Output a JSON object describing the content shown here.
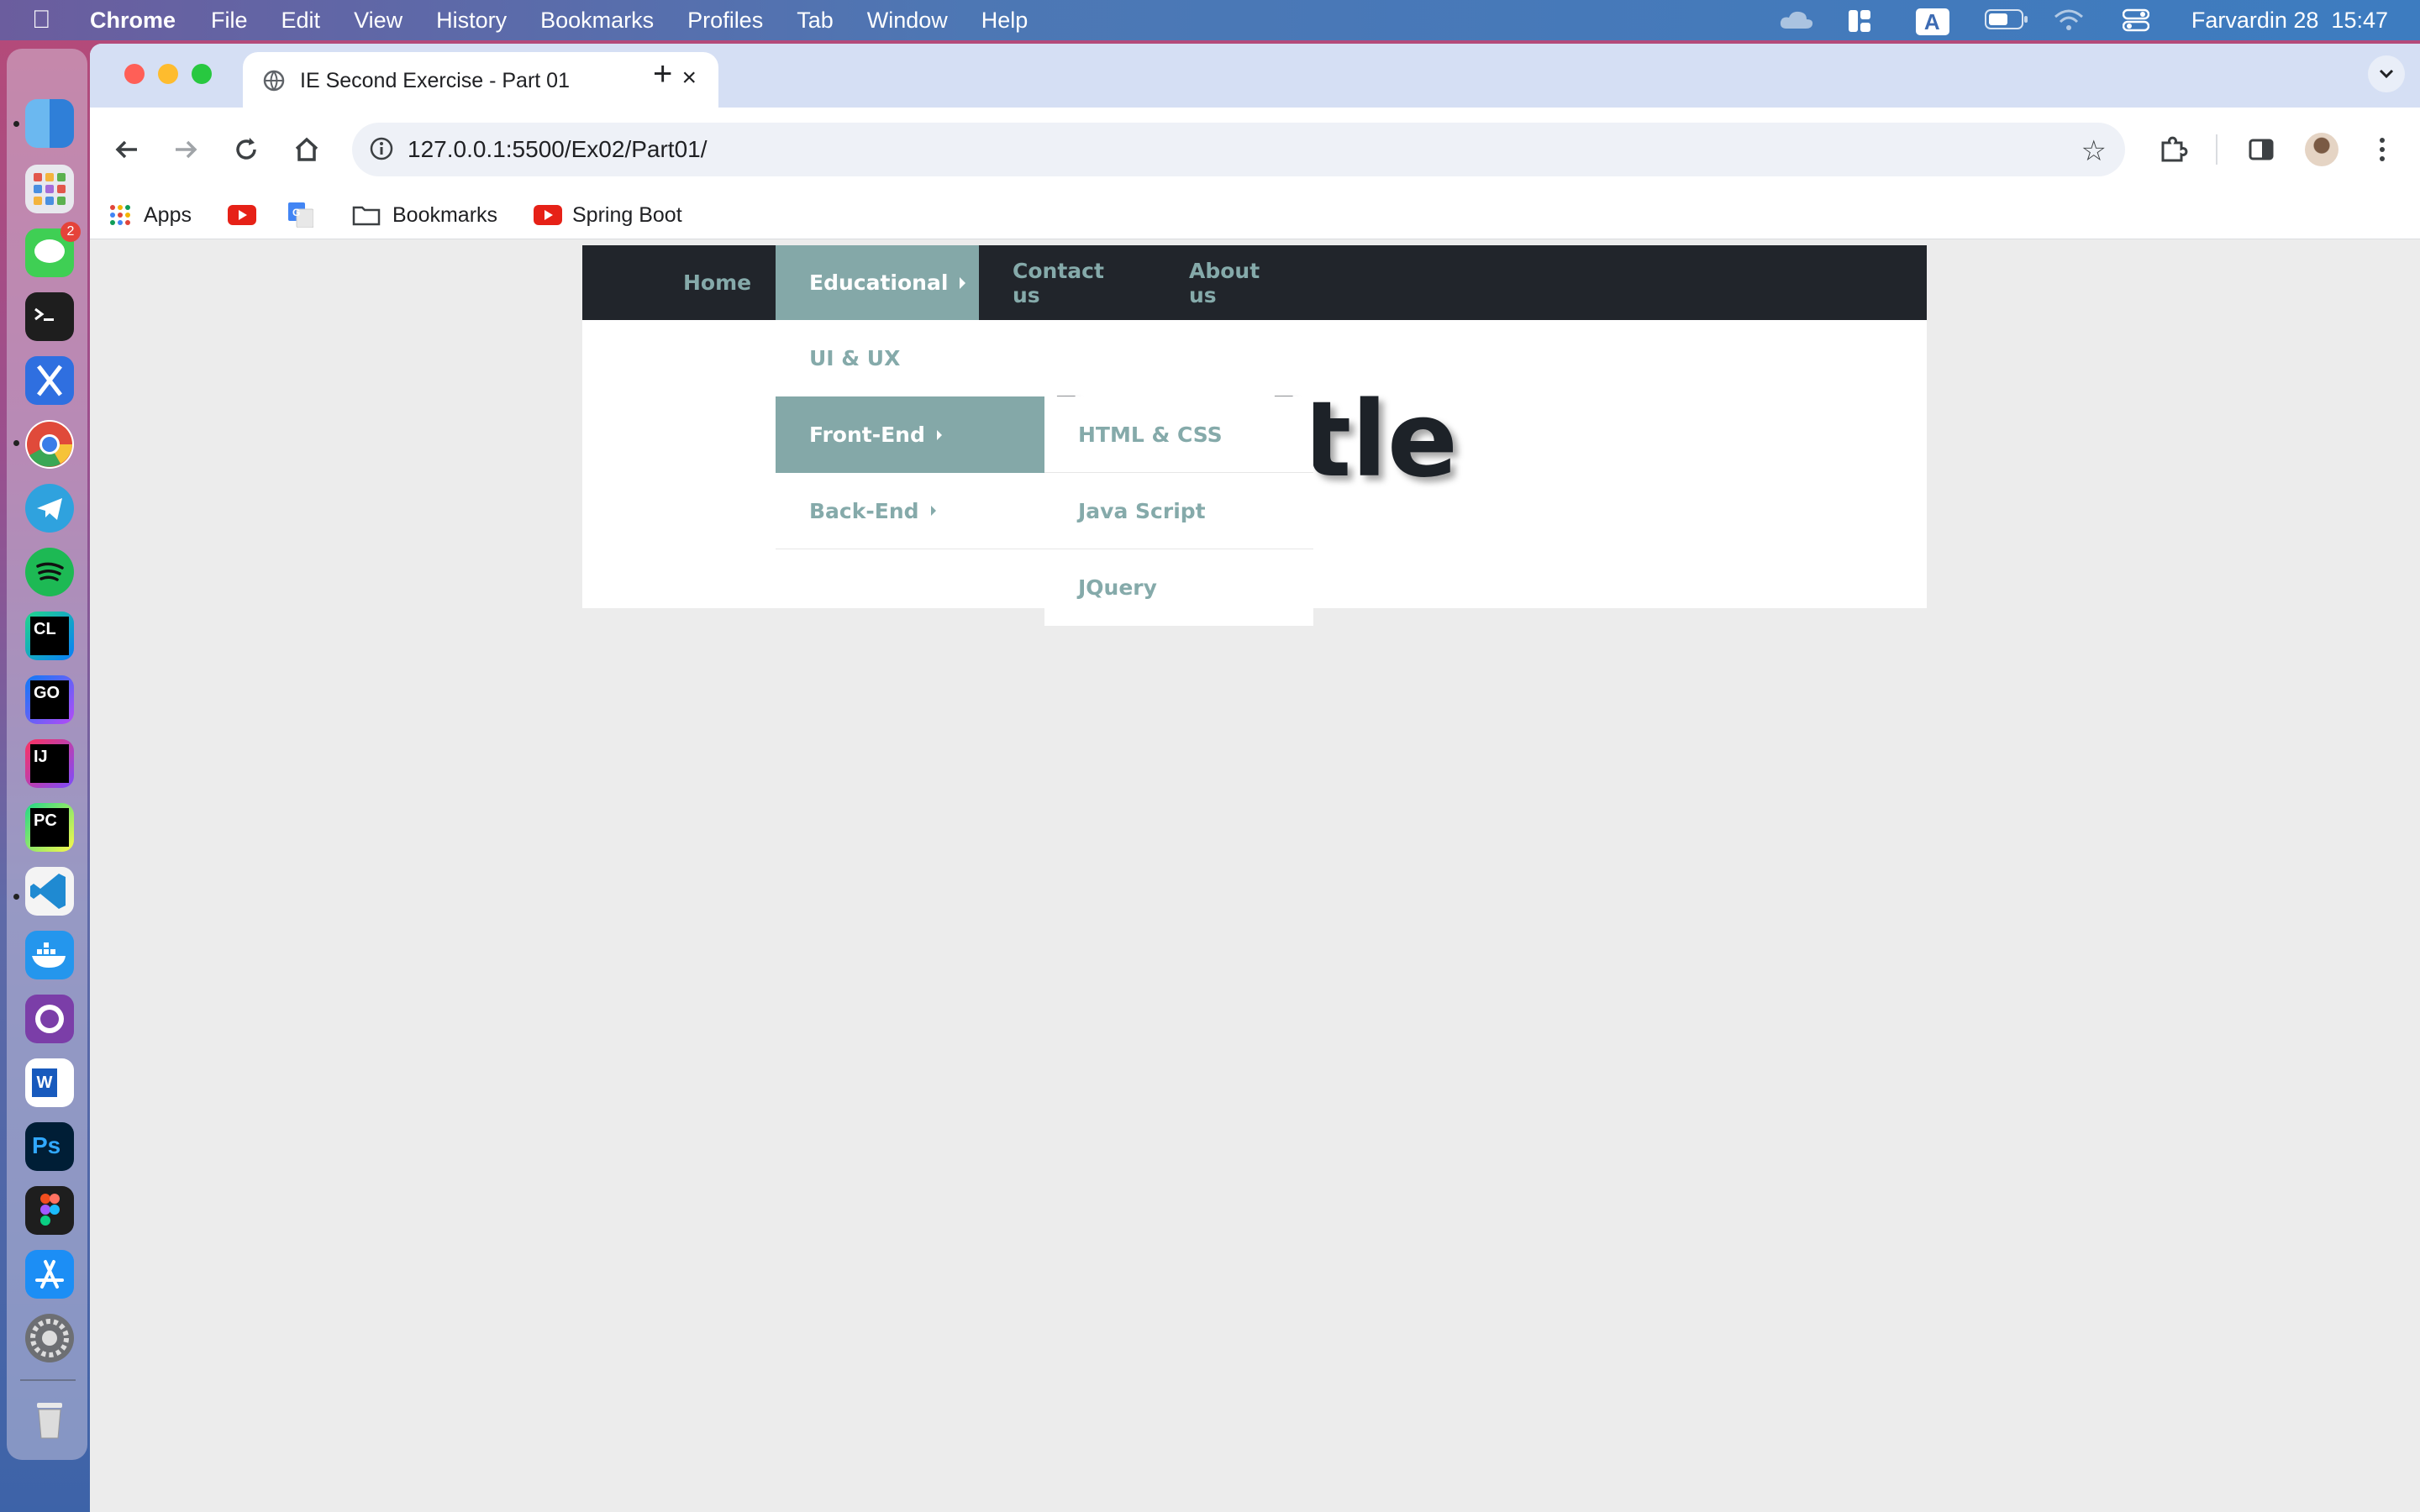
{
  "menubar": {
    "app_name": "Chrome",
    "items": [
      "File",
      "Edit",
      "View",
      "History",
      "Bookmarks",
      "Profiles",
      "Tab",
      "Window",
      "Help"
    ],
    "input_source": "A",
    "clock": "Farvardin 28  15:47"
  },
  "dock": {
    "apps": [
      "finder-icon",
      "launchpad-icon",
      "messages-icon",
      "terminal-icon",
      "xcode-icon",
      "chrome-icon",
      "telegram-icon",
      "spotify-icon",
      "clion-icon",
      "goland-icon",
      "intellij-icon",
      "pycharm-icon",
      "vscode-icon",
      "docker-icon",
      "github-desktop-icon",
      "word-icon",
      "photoshop-icon",
      "figma-icon",
      "app-store-icon",
      "system-settings-icon",
      "trash-icon"
    ],
    "messages_badge": "2"
  },
  "browser": {
    "tab_title": "IE Second Exercise - Part 01",
    "url": "127.0.0.1:5500/Ex02/Part01/",
    "bookmarks": {
      "apps": "Apps",
      "folder": "Bookmarks",
      "spring": "Spring Boot"
    }
  },
  "page": {
    "nav": {
      "home": "Home",
      "educational": "Educational",
      "contact": "Contact us",
      "about": "About us"
    },
    "title": "Big Title",
    "dropdown": {
      "ui_ux": "UI & UX",
      "front_end": "Front-End",
      "back_end": "Back-End"
    },
    "submenu": {
      "html_css": "HTML & CSS",
      "javascript": "Java Script",
      "jquery": "JQuery"
    }
  },
  "colors": {
    "navbar_bg": "#21252b",
    "accent": "#84a8a8",
    "link": "#85aaaa",
    "page_bg": "#ececec"
  }
}
